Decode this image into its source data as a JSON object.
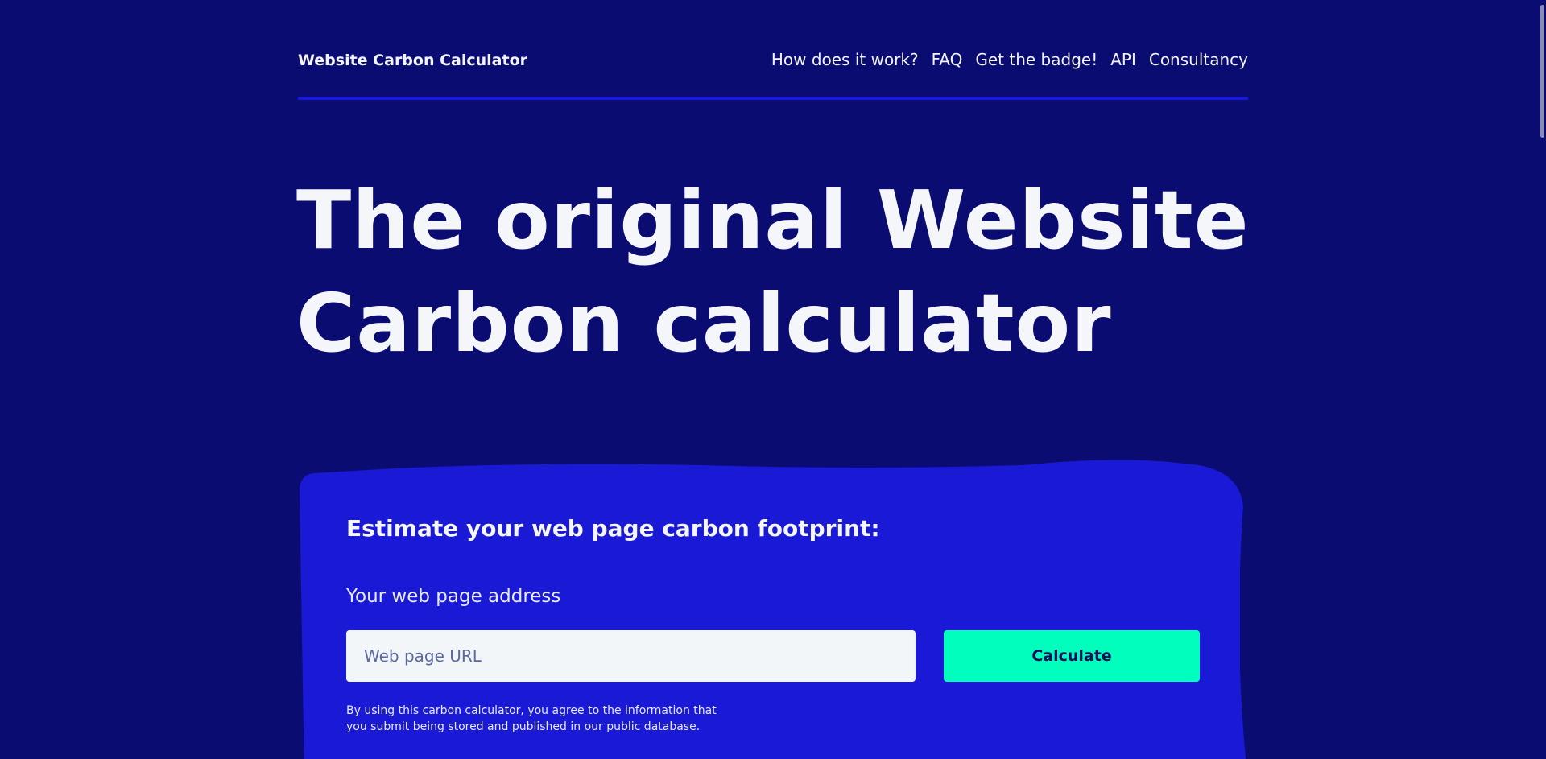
{
  "header": {
    "brand": "Website Carbon Calculator",
    "nav": [
      {
        "label": "How does it work?"
      },
      {
        "label": "FAQ"
      },
      {
        "label": "Get the badge!"
      },
      {
        "label": "API"
      },
      {
        "label": "Consultancy"
      }
    ]
  },
  "hero": {
    "title_line1": "The original Website",
    "title_line2": "Carbon calculator"
  },
  "form": {
    "heading": "Estimate your web page carbon footprint:",
    "url_label": "Your web page address",
    "url_placeholder": "Web page URL",
    "url_value": "",
    "submit_label": "Calculate",
    "disclaimer": "By using this carbon calculator, you agree to the information that you submit being stored and published in our public database."
  },
  "colors": {
    "background": "#0a0c72",
    "card": "#1919d6",
    "accent_button": "#00ffbd",
    "text": "#f2f4f8"
  }
}
